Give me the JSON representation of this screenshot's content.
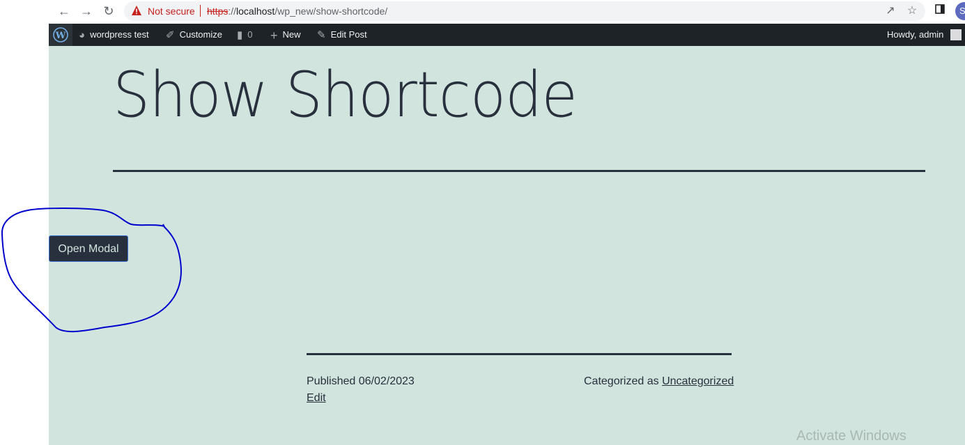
{
  "browser": {
    "warning_text": "Not secure",
    "url_scheme": "https",
    "url_sep": "://",
    "url_host": "localhost",
    "url_path": "/wp_new/show-shortcode/",
    "profile_initial": "S",
    "icons": [
      "back-icon",
      "forward-icon",
      "reload-icon",
      "warning-icon",
      "share-icon",
      "star-icon",
      "side-panel-icon"
    ]
  },
  "adminbar": {
    "site_name": "wordpress test",
    "customize": "Customize",
    "comments_count": "0",
    "new": "New",
    "edit_post": "Edit Post",
    "howdy": "Howdy, admin"
  },
  "page": {
    "title": "Show Shortcode",
    "button_label": "Open Modal",
    "published": "Published 06/02/2023",
    "edit": "Edit",
    "categorized_prefix": "Categorized as ",
    "category": "Uncategorized",
    "watermark": "Activate Windows"
  },
  "colors": {
    "background": "#d1e4dd",
    "text": "#28303d",
    "adminbar": "#1d2327",
    "annotation": "#0000cc"
  }
}
